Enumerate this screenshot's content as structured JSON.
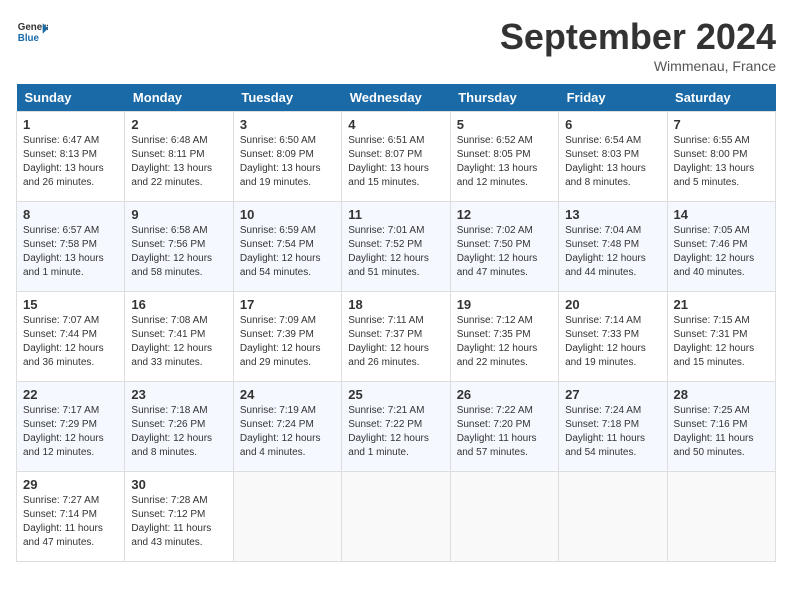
{
  "header": {
    "logo_line1": "General",
    "logo_line2": "Blue",
    "title": "September 2024",
    "subtitle": "Wimmenau, France"
  },
  "weekdays": [
    "Sunday",
    "Monday",
    "Tuesday",
    "Wednesday",
    "Thursday",
    "Friday",
    "Saturday"
  ],
  "weeks": [
    [
      {
        "day": "1",
        "info": "Sunrise: 6:47 AM\nSunset: 8:13 PM\nDaylight: 13 hours\nand 26 minutes."
      },
      {
        "day": "2",
        "info": "Sunrise: 6:48 AM\nSunset: 8:11 PM\nDaylight: 13 hours\nand 22 minutes."
      },
      {
        "day": "3",
        "info": "Sunrise: 6:50 AM\nSunset: 8:09 PM\nDaylight: 13 hours\nand 19 minutes."
      },
      {
        "day": "4",
        "info": "Sunrise: 6:51 AM\nSunset: 8:07 PM\nDaylight: 13 hours\nand 15 minutes."
      },
      {
        "day": "5",
        "info": "Sunrise: 6:52 AM\nSunset: 8:05 PM\nDaylight: 13 hours\nand 12 minutes."
      },
      {
        "day": "6",
        "info": "Sunrise: 6:54 AM\nSunset: 8:03 PM\nDaylight: 13 hours\nand 8 minutes."
      },
      {
        "day": "7",
        "info": "Sunrise: 6:55 AM\nSunset: 8:00 PM\nDaylight: 13 hours\nand 5 minutes."
      }
    ],
    [
      {
        "day": "8",
        "info": "Sunrise: 6:57 AM\nSunset: 7:58 PM\nDaylight: 13 hours\nand 1 minute."
      },
      {
        "day": "9",
        "info": "Sunrise: 6:58 AM\nSunset: 7:56 PM\nDaylight: 12 hours\nand 58 minutes."
      },
      {
        "day": "10",
        "info": "Sunrise: 6:59 AM\nSunset: 7:54 PM\nDaylight: 12 hours\nand 54 minutes."
      },
      {
        "day": "11",
        "info": "Sunrise: 7:01 AM\nSunset: 7:52 PM\nDaylight: 12 hours\nand 51 minutes."
      },
      {
        "day": "12",
        "info": "Sunrise: 7:02 AM\nSunset: 7:50 PM\nDaylight: 12 hours\nand 47 minutes."
      },
      {
        "day": "13",
        "info": "Sunrise: 7:04 AM\nSunset: 7:48 PM\nDaylight: 12 hours\nand 44 minutes."
      },
      {
        "day": "14",
        "info": "Sunrise: 7:05 AM\nSunset: 7:46 PM\nDaylight: 12 hours\nand 40 minutes."
      }
    ],
    [
      {
        "day": "15",
        "info": "Sunrise: 7:07 AM\nSunset: 7:44 PM\nDaylight: 12 hours\nand 36 minutes."
      },
      {
        "day": "16",
        "info": "Sunrise: 7:08 AM\nSunset: 7:41 PM\nDaylight: 12 hours\nand 33 minutes."
      },
      {
        "day": "17",
        "info": "Sunrise: 7:09 AM\nSunset: 7:39 PM\nDaylight: 12 hours\nand 29 minutes."
      },
      {
        "day": "18",
        "info": "Sunrise: 7:11 AM\nSunset: 7:37 PM\nDaylight: 12 hours\nand 26 minutes."
      },
      {
        "day": "19",
        "info": "Sunrise: 7:12 AM\nSunset: 7:35 PM\nDaylight: 12 hours\nand 22 minutes."
      },
      {
        "day": "20",
        "info": "Sunrise: 7:14 AM\nSunset: 7:33 PM\nDaylight: 12 hours\nand 19 minutes."
      },
      {
        "day": "21",
        "info": "Sunrise: 7:15 AM\nSunset: 7:31 PM\nDaylight: 12 hours\nand 15 minutes."
      }
    ],
    [
      {
        "day": "22",
        "info": "Sunrise: 7:17 AM\nSunset: 7:29 PM\nDaylight: 12 hours\nand 12 minutes."
      },
      {
        "day": "23",
        "info": "Sunrise: 7:18 AM\nSunset: 7:26 PM\nDaylight: 12 hours\nand 8 minutes."
      },
      {
        "day": "24",
        "info": "Sunrise: 7:19 AM\nSunset: 7:24 PM\nDaylight: 12 hours\nand 4 minutes."
      },
      {
        "day": "25",
        "info": "Sunrise: 7:21 AM\nSunset: 7:22 PM\nDaylight: 12 hours\nand 1 minute."
      },
      {
        "day": "26",
        "info": "Sunrise: 7:22 AM\nSunset: 7:20 PM\nDaylight: 11 hours\nand 57 minutes."
      },
      {
        "day": "27",
        "info": "Sunrise: 7:24 AM\nSunset: 7:18 PM\nDaylight: 11 hours\nand 54 minutes."
      },
      {
        "day": "28",
        "info": "Sunrise: 7:25 AM\nSunset: 7:16 PM\nDaylight: 11 hours\nand 50 minutes."
      }
    ],
    [
      {
        "day": "29",
        "info": "Sunrise: 7:27 AM\nSunset: 7:14 PM\nDaylight: 11 hours\nand 47 minutes."
      },
      {
        "day": "30",
        "info": "Sunrise: 7:28 AM\nSunset: 7:12 PM\nDaylight: 11 hours\nand 43 minutes."
      },
      {
        "day": "",
        "info": ""
      },
      {
        "day": "",
        "info": ""
      },
      {
        "day": "",
        "info": ""
      },
      {
        "day": "",
        "info": ""
      },
      {
        "day": "",
        "info": ""
      }
    ]
  ]
}
